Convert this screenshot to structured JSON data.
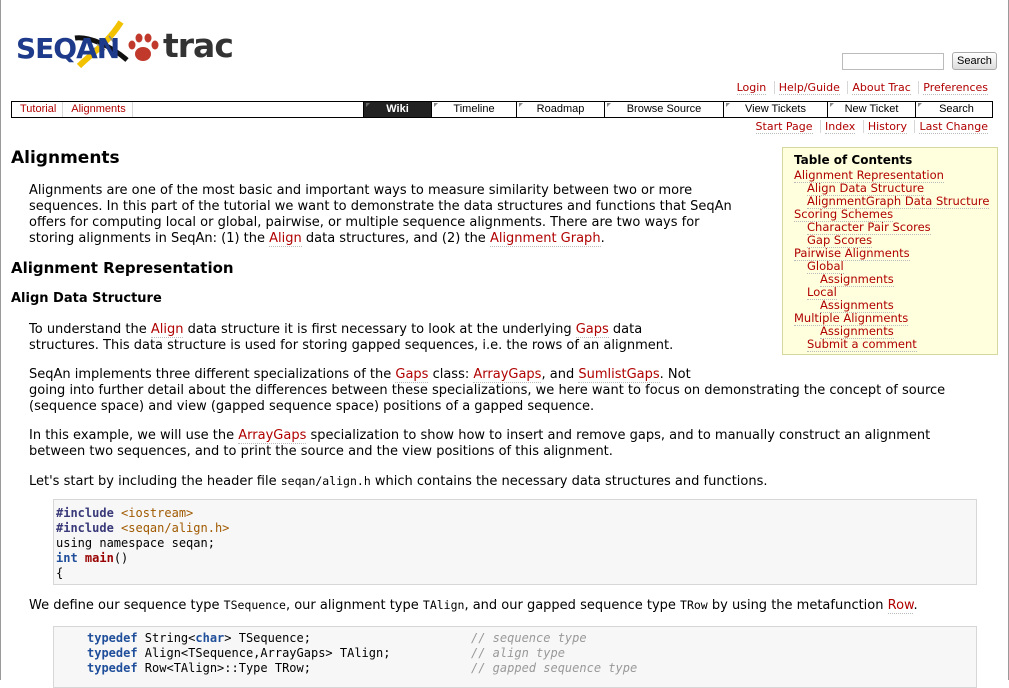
{
  "header": {
    "logo_left": "SEQAN",
    "logo_right": "trac",
    "search_button": "Search",
    "search_placeholder": ""
  },
  "metanav": [
    "Login",
    "Help/Guide",
    "About Trac",
    "Preferences"
  ],
  "context_links": [
    "Tutorial",
    "Alignments"
  ],
  "mainnav": [
    "Wiki",
    "Timeline",
    "Roadmap",
    "Browse Source",
    "View Tickets",
    "New Ticket",
    "Search"
  ],
  "ctxnav": [
    "Start Page",
    "Index",
    "History",
    "Last Change"
  ],
  "page": {
    "title": "Alignments",
    "intro": {
      "l1": "Alignments are one of the most basic and important ways to measure similarity between two or more",
      "l2": "sequences. In this part of the tutorial we want to demonstrate the data structures and functions that SeqAn",
      "l3": "offers for computing local or global, pairwise, or multiple sequence alignments. There are two ways for",
      "l4a": "storing alignments in SeqAn: (1) the ",
      "l4link1": "Align",
      "l4b": " data structures, and (2) the ",
      "l4link2": "Alignment Graph",
      "l4c": "."
    },
    "section1": "Alignment Representation",
    "subsection1": "Align Data Structure",
    "p1": {
      "a": "To understand the ",
      "link1": "Align",
      "b": " data structure it is first necessary to look at the underlying ",
      "link2": "Gaps",
      "c": " data",
      "l2": "structures. This data structure is used for storing gapped sequences, i.e. the rows of an alignment."
    },
    "p2": {
      "a": "SeqAn implements three different specializations of the ",
      "link1": "Gaps",
      "b": " class: ",
      "link2": "ArrayGaps",
      "c": ", and ",
      "link3": "SumlistGaps",
      "d": ". Not",
      "l2": "going into further detail about the differences between these specializations, we here want to focus on demonstrating the concept of source",
      "l3": "(sequence space) and view (gapped sequence space) positions of a gapped sequence."
    },
    "p3": {
      "a": "In this example, we will use the ",
      "link1": "ArrayGaps",
      "b": " specialization to show how to insert and remove gaps, and to manually construct an alignment",
      "l2": "between two sequences, and to print the source and the view positions of this alignment."
    },
    "p4": {
      "a": "Let's start by including the header file ",
      "code": "seqan/align.h",
      "b": " which contains the necessary data structures and functions."
    },
    "code1": {
      "inc_kw": "#include",
      "inc1": "<iostream>",
      "inc2": "<seqan/align.h>",
      "l3": "using namespace seqan;",
      "l4_kw": "int",
      "l4_fn": "main",
      "l4_rest": "()",
      "l5": "{"
    },
    "p5": {
      "a": "We define our sequence type ",
      "c1": "TSequence",
      "b": ", our alignment type ",
      "c2": "TAlign",
      "c": ", and our gapped sequence type ",
      "c3": "TRow",
      "d": " by using the metafunction ",
      "link": "Row",
      "e": "."
    },
    "code2": {
      "kw": "typedef",
      "l1": " String<",
      "l1kw": "char",
      "l1b": "> TSequence;",
      "l1c": "// sequence type",
      "l2": " Align<TSequence,ArrayGaps> TAlign;",
      "l2c": "// align type",
      "l3": " Row<TAlign>::Type TRow;",
      "l3c": "// gapped sequence type"
    }
  },
  "toc": {
    "title": "Table of Contents",
    "entries": [
      "Alignment Representation",
      "Align Data Structure",
      "AlignmentGraph Data Structure",
      "Scoring Schemes",
      "Character Pair Scores",
      "Gap Scores",
      "Pairwise Alignments",
      "Global",
      "Assignments",
      "Local",
      "Assignments",
      "Multiple Alignments",
      "Assignments",
      "Submit a comment"
    ]
  }
}
